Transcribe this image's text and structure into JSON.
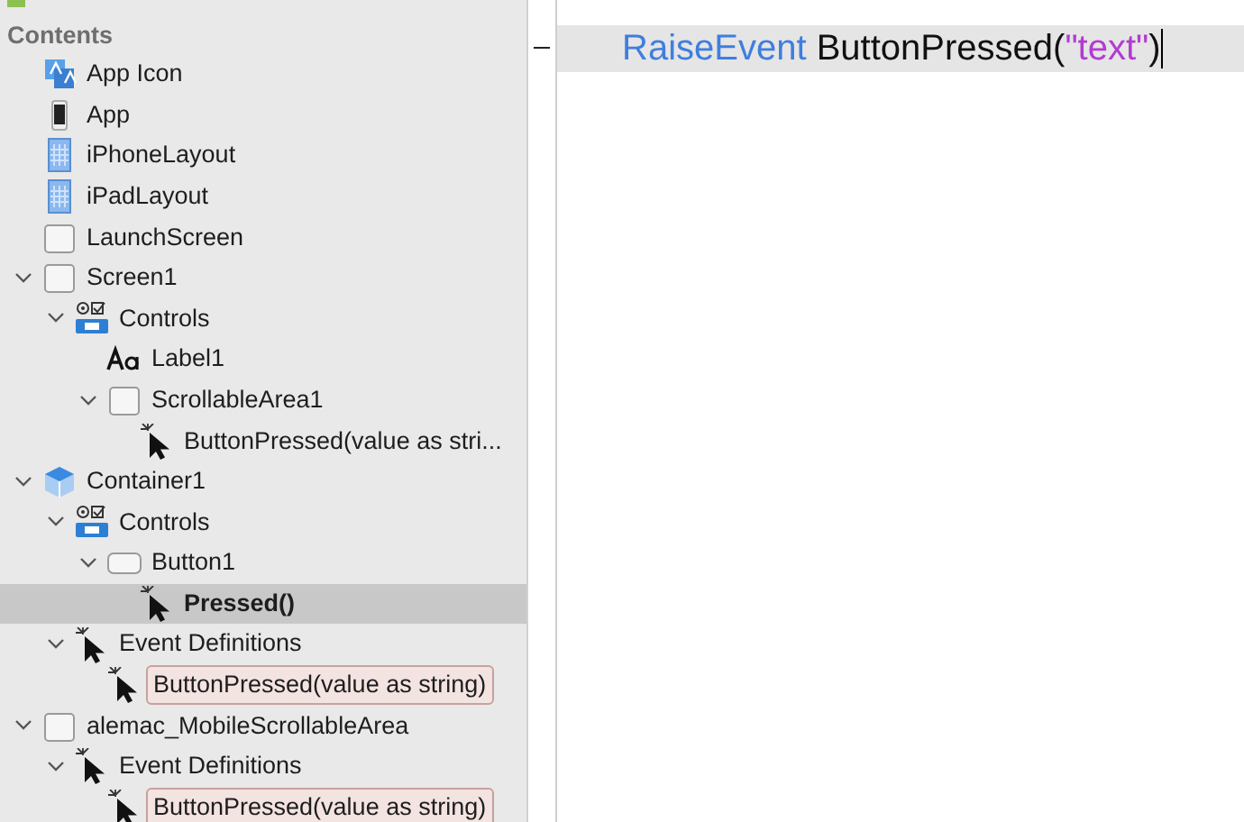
{
  "sidebar": {
    "heading": "Contents",
    "items": [
      {
        "label": "App Icon",
        "kind": "app-icon",
        "selected": false,
        "boxed": false
      },
      {
        "label": "App",
        "kind": "phone",
        "selected": false,
        "boxed": false
      },
      {
        "label": "iPhoneLayout",
        "kind": "layout",
        "selected": false,
        "boxed": false
      },
      {
        "label": "iPadLayout",
        "kind": "layout",
        "selected": false,
        "boxed": false
      },
      {
        "label": "LaunchScreen",
        "kind": "screen",
        "selected": false,
        "boxed": false
      },
      {
        "label": "Screen1",
        "kind": "screen",
        "selected": false,
        "boxed": false,
        "expanded": true,
        "children": [
          {
            "label": "Controls",
            "kind": "controls",
            "selected": false,
            "boxed": false,
            "expanded": true,
            "children": [
              {
                "label": "Label1",
                "kind": "label",
                "selected": false,
                "boxed": false
              },
              {
                "label": "ScrollableArea1",
                "kind": "screen",
                "selected": false,
                "boxed": false,
                "expanded": true,
                "children": [
                  {
                    "label": "ButtonPressed(value as stri...",
                    "kind": "event",
                    "selected": false,
                    "boxed": false
                  }
                ]
              }
            ]
          }
        ]
      },
      {
        "label": "Container1",
        "kind": "container",
        "selected": false,
        "boxed": false,
        "expanded": true,
        "children": [
          {
            "label": "Controls",
            "kind": "controls",
            "selected": false,
            "boxed": false,
            "expanded": true,
            "children": [
              {
                "label": "Button1",
                "kind": "button",
                "selected": false,
                "boxed": false,
                "expanded": true,
                "children": [
                  {
                    "label": "Pressed()",
                    "kind": "event",
                    "selected": true,
                    "boxed": false
                  }
                ]
              }
            ]
          },
          {
            "label": "Event Definitions",
            "kind": "event",
            "selected": false,
            "boxed": false,
            "expanded": true,
            "children": [
              {
                "label": "ButtonPressed(value as string)",
                "kind": "event",
                "selected": false,
                "boxed": true
              }
            ]
          }
        ]
      },
      {
        "label": "alemac_MobileScrollableArea",
        "kind": "screen",
        "selected": false,
        "boxed": false,
        "expanded": true,
        "children": [
          {
            "label": "Event Definitions",
            "kind": "event",
            "selected": false,
            "boxed": false,
            "expanded": true,
            "children": [
              {
                "label": "ButtonPressed(value as string)",
                "kind": "event",
                "selected": false,
                "boxed": true
              }
            ]
          }
        ]
      }
    ]
  },
  "editor": {
    "lines": [
      {
        "current": true,
        "tokens": [
          {
            "kind": "keyword",
            "text": "RaiseEvent"
          },
          {
            "kind": "plain",
            "text": " ButtonPressed("
          },
          {
            "kind": "string",
            "text": "\"text\""
          },
          {
            "kind": "plain",
            "text": ")"
          }
        ]
      }
    ]
  }
}
